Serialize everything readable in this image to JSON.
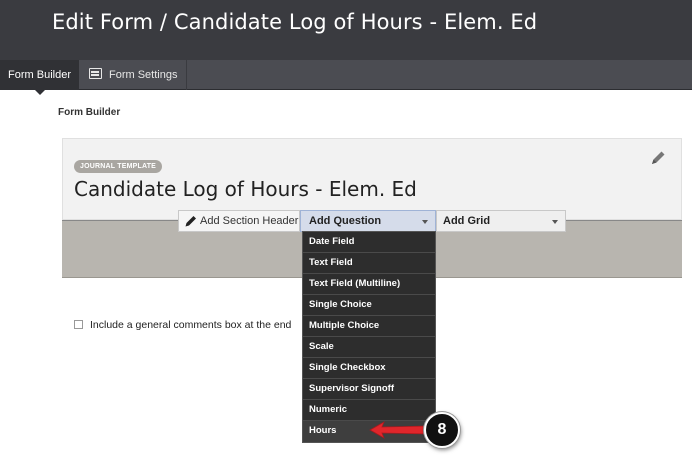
{
  "header": {
    "title": "Edit Form / Candidate Log of Hours - Elem. Ed"
  },
  "tabs": [
    {
      "label": "Form Builder",
      "active": true,
      "icon": "none"
    },
    {
      "label": "Form Settings",
      "active": false,
      "icon": "settings-sliders-icon"
    }
  ],
  "section_label": "Form Builder",
  "form": {
    "badge": "JOURNAL TEMPLATE",
    "title": "Candidate Log of Hours - Elem. Ed",
    "comments_label": "Include a general comments box at the end"
  },
  "toolbar": {
    "add_section_header": "Add Section Header",
    "add_question": "Add Question",
    "add_grid": "Add Grid"
  },
  "dropdown": {
    "items": [
      "Date Field",
      "Text Field",
      "Text Field (Multiline)",
      "Single Choice",
      "Multiple Choice",
      "Scale",
      "Single Checkbox",
      "Supervisor Signoff",
      "Numeric",
      "Hours"
    ],
    "highlighted": "Hours"
  },
  "callout": {
    "number": "8",
    "color": "#e0262b"
  },
  "colors": {
    "topbar": "#3a3b40",
    "accent_selected": "#d5dcea"
  }
}
